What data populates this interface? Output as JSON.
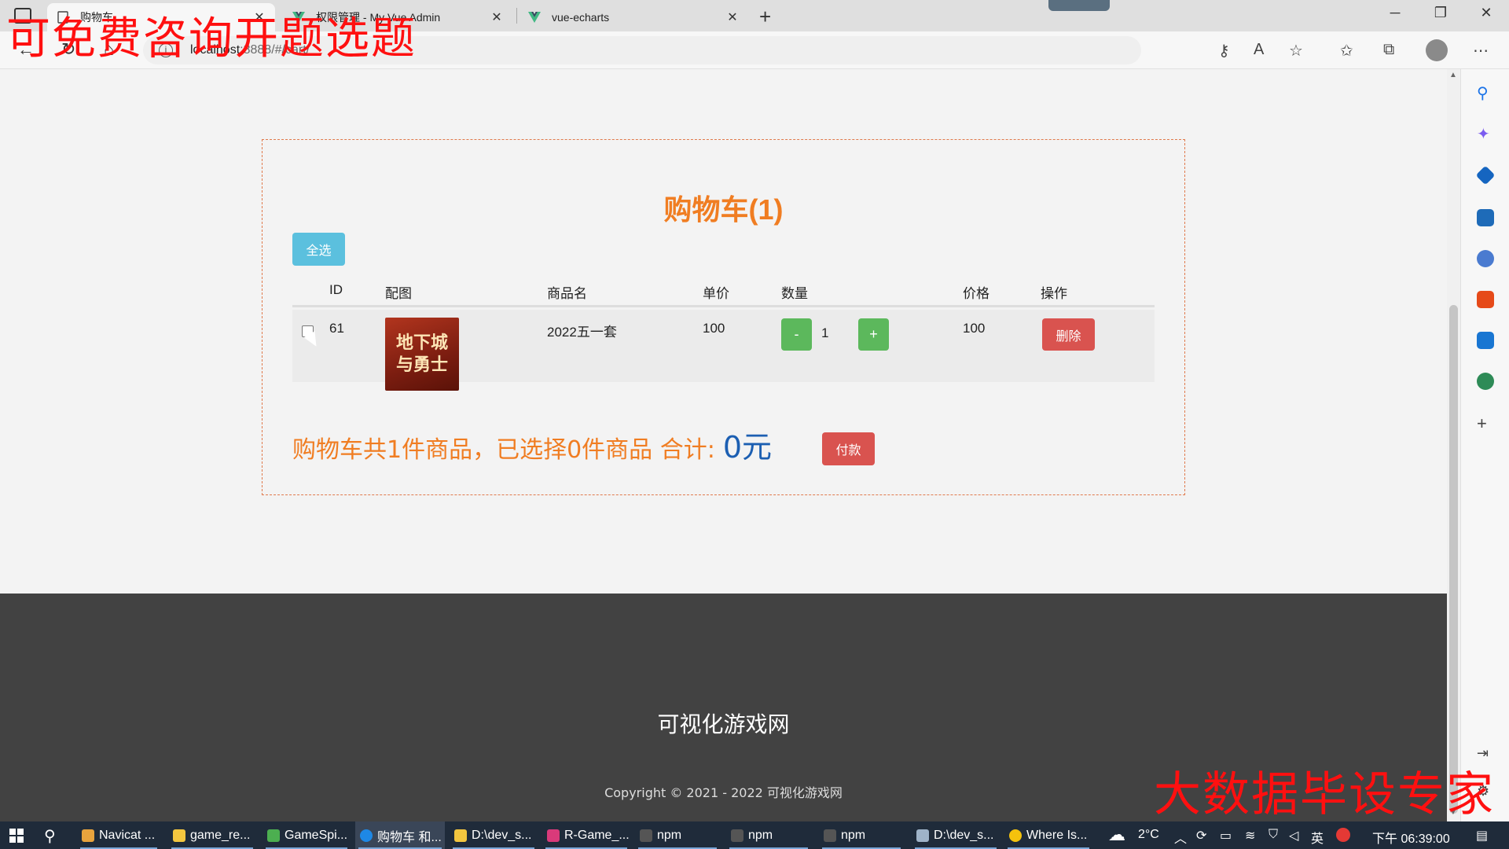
{
  "browser": {
    "tabs": [
      {
        "title": "购物车",
        "active": true
      },
      {
        "title": "权限管理 - My Vue Admin",
        "active": false
      },
      {
        "title": "vue-echarts",
        "active": false
      }
    ],
    "url_host": "localhost",
    "url_rest": ":8888/#/cart/",
    "new_tab_symbol": "+",
    "window_controls": {
      "minimize": "─",
      "maximize": "❐",
      "close": "✕"
    }
  },
  "watermarks": {
    "top": "可免费咨询开题选题",
    "bottom": "大数据毕设专家"
  },
  "cart": {
    "title": "购物车(1)",
    "select_all_label": "全选",
    "columns": [
      "ID",
      "配图",
      "商品名",
      "单价",
      "数量",
      "价格",
      "操作"
    ],
    "items": [
      {
        "id": "61",
        "image_text_line1": "地下城",
        "image_text_line2": "与勇士",
        "name": "2022五一套",
        "unit_price": "100",
        "quantity": "1",
        "price": "100",
        "minus_label": "-",
        "plus_label": "+",
        "delete_label": "删除",
        "checked": false
      }
    ],
    "summary_text": "购物车共1件商品，已选择0件商品 合计:",
    "total": "0元",
    "pay_label": "付款"
  },
  "footer": {
    "site_name": "可视化游戏网",
    "copyright": "Copyright © 2021 - 2022 可视化游戏网"
  },
  "taskbar": {
    "apps": [
      {
        "label": "Navicat ...",
        "color": "#e8a33d"
      },
      {
        "label": "game_re...",
        "color": "#f3c63f"
      },
      {
        "label": "GameSpi...",
        "color": "#4caf50"
      },
      {
        "label": "购物车 和...",
        "color": "#1e88e5",
        "active": true
      },
      {
        "label": "D:\\dev_s...",
        "color": "#f3c63f"
      },
      {
        "label": "R-Game_...",
        "color": "#d93a7a"
      },
      {
        "label": "npm",
        "color": "#555555"
      },
      {
        "label": "npm",
        "color": "#555555"
      },
      {
        "label": "npm",
        "color": "#555555"
      },
      {
        "label": "D:\\dev_s...",
        "color": "#9fb3c8"
      },
      {
        "label": "Where Is...",
        "color": "#f4c20d"
      }
    ],
    "weather": "2°C",
    "ime": "英",
    "clock": "下午 06:39:00"
  }
}
